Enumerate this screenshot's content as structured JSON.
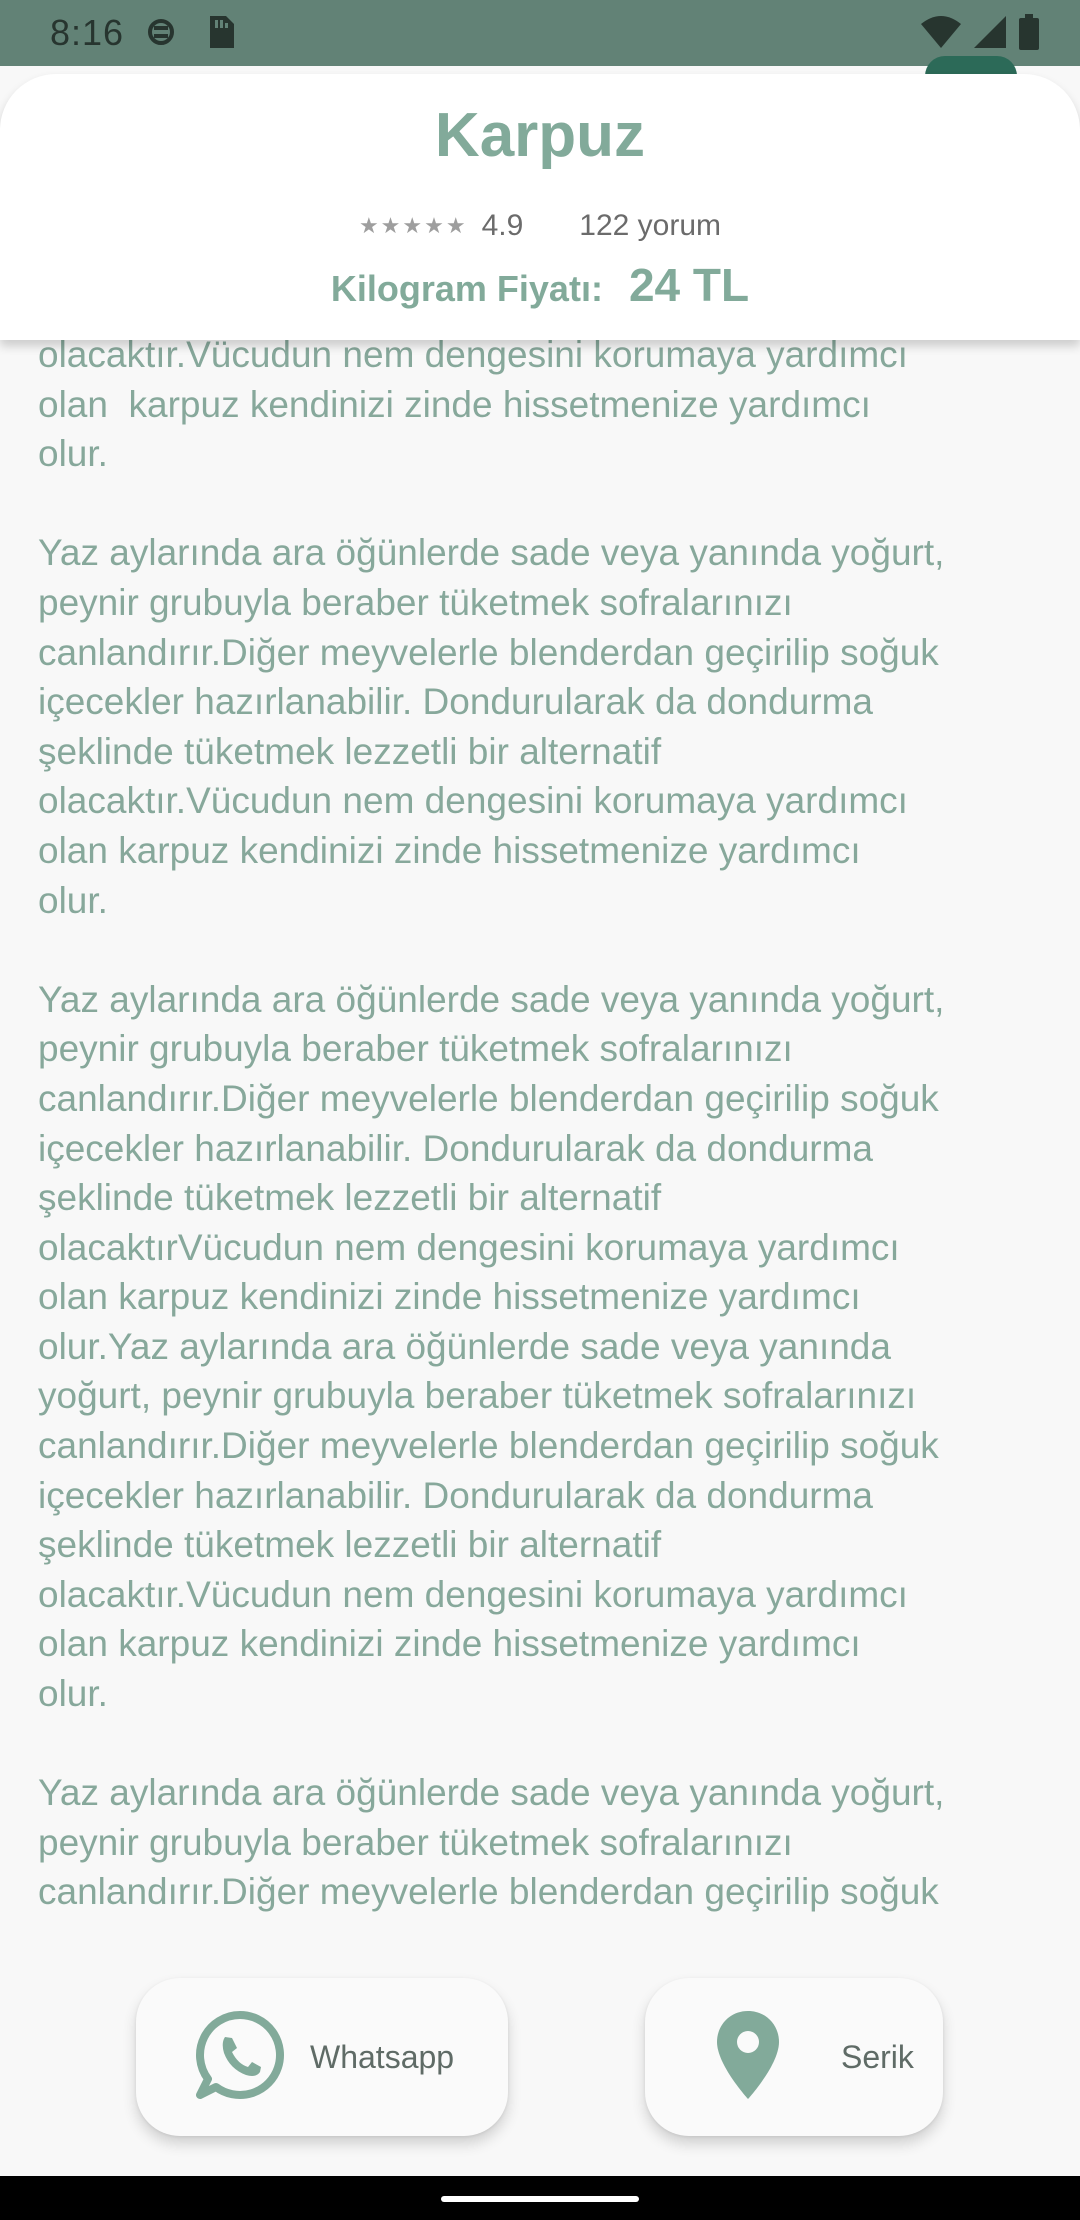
{
  "status_bar": {
    "time": "8:16",
    "icons": [
      "data-saver-icon",
      "sim-card-icon",
      "wifi-icon",
      "signal-icon",
      "battery-icon"
    ]
  },
  "product": {
    "title": "Karpuz",
    "stars": "★★★★★",
    "rating": "4.9",
    "reviews": "122 yorum",
    "price_label": "Kilogram Fiyatı:",
    "price_value": "24 TL"
  },
  "description": "olacaktır.Vücudun nem dengesini korumaya yardımcı\nolan  karpuz kendinizi zinde hissetmenize yardımcı\nolur.\n\nYaz aylarında ara öğünlerde sade veya yanında yoğurt,\npeynir grubuyla beraber tüketmek sofralarınızı\ncanlandırır.Diğer meyvelerle blenderdan geçirilip soğuk\niçecekler hazırlanabilir. Dondurularak da dondurma\nşeklinde tüketmek lezzetli bir alternatif\nolacaktır.Vücudun nem dengesini korumaya yardımcı\nolan karpuz kendinizi zinde hissetmenize yardımcı\nolur.\n\nYaz aylarında ara öğünlerde sade veya yanında yoğurt,\npeynir grubuyla beraber tüketmek sofralarınızı\ncanlandırır.Diğer meyvelerle blenderdan geçirilip soğuk\niçecekler hazırlanabilir. Dondurularak da dondurma\nşeklinde tüketmek lezzetli bir alternatif\nolacaktırVücudun nem dengesini korumaya yardımcı\nolan karpuz kendinizi zinde hissetmenize yardımcı\nolur.Yaz aylarında ara öğünlerde sade veya yanında\nyoğurt, peynir grubuyla beraber tüketmek sofralarınızı\ncanlandırır.Diğer meyvelerle blenderdan geçirilip soğuk\niçecekler hazırlanabilir. Dondurularak da dondurma\nşeklinde tüketmek lezzetli bir alternatif\nolacaktır.Vücudun nem dengesini korumaya yardımcı\nolan karpuz kendinizi zinde hissetmenize yardımcı\nolur.\n\nYaz aylarında ara öğünlerde sade veya yanında yoğurt,\npeynir grubuyla beraber tüketmek sofralarınızı\ncanlandırır.Diğer meyvelerle blenderdan geçirilip soğuk",
  "actions": {
    "whatsapp_label": "Whatsapp",
    "location_label": "Serik"
  },
  "colors": {
    "accent": "#82aa9a",
    "status_bar": "#628276",
    "text": "#87a89b"
  }
}
